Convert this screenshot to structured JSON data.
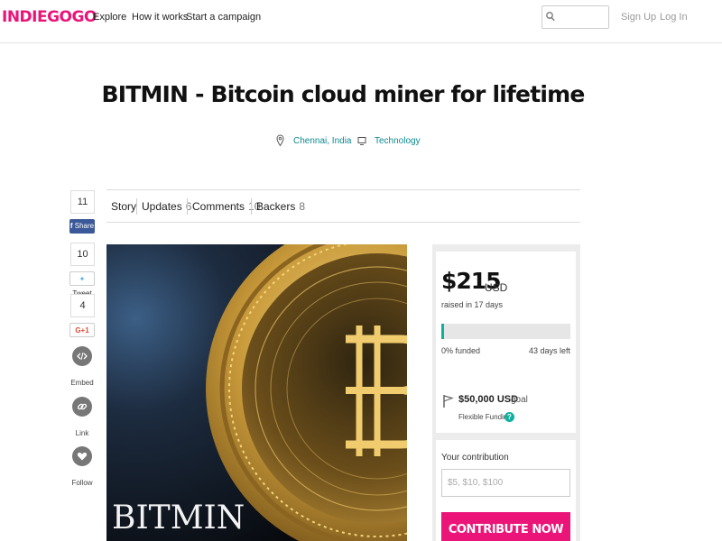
{
  "brand": {
    "logo": "INDIEGOGO",
    "accent": "#eb1478",
    "teal": "#0fb09e"
  },
  "nav": {
    "explore": "Explore",
    "how_it_works": "How it works",
    "start_campaign": "Start a campaign"
  },
  "search": {
    "placeholder": "",
    "icon": "search-icon"
  },
  "auth": {
    "sign_up": "Sign Up",
    "log_in": "Log In"
  },
  "campaign": {
    "title": "BITMIN - Bitcoin cloud miner for lifetime",
    "location": "Chennai, India",
    "category": "Technology",
    "image_caption": "BITMIN"
  },
  "social": {
    "facebook_count": "11",
    "facebook_label": "Share",
    "twitter_count": "10",
    "twitter_label": "Tweet",
    "google_count": "4",
    "google_label": "G+1",
    "embed_label": "Embed",
    "link_label": "Link",
    "follow_label": "Follow"
  },
  "tabs": [
    {
      "label": "Story",
      "count": ""
    },
    {
      "label": "Updates",
      "count": "6"
    },
    {
      "label": "Comments",
      "count": "10"
    },
    {
      "label": "Backers",
      "count": "8"
    }
  ],
  "funding": {
    "raised": "$215",
    "currency": "USD",
    "raised_in": "raised in 17 days",
    "progress_fraction": 0.02,
    "funded_pct": "0% funded",
    "days_left": "43 days left",
    "goal_amount": "$50,000 USD",
    "goal_word": "goal",
    "funding_type": "Flexible Funding",
    "help_glyph": "?"
  },
  "contribution": {
    "label": "Your contribution",
    "placeholder": "$5, $10, $100",
    "button": "CONTRIBUTE NOW"
  }
}
